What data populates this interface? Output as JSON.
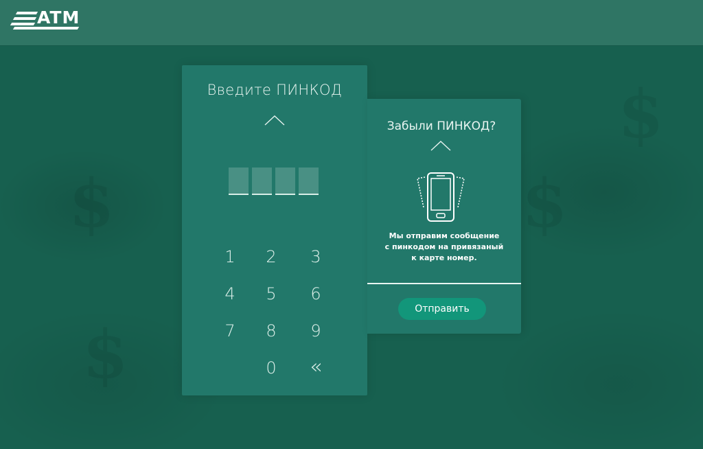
{
  "app": {
    "logo_text": "ATM"
  },
  "pin_panel": {
    "title": "Введите ПИНКОД",
    "digit_count": 4,
    "keys": [
      "1",
      "2",
      "3",
      "4",
      "5",
      "6",
      "7",
      "8",
      "9",
      "0",
      "«"
    ]
  },
  "forgot_panel": {
    "title": "Забыли ПИНКОД?",
    "message_line1": "Мы отправим сообщение",
    "message_line2": "с пинкодом на привязаный",
    "message_line3": "к карте номер.",
    "send_label": "Отправить"
  },
  "icons": {
    "caret_up": "chevron-up-icon",
    "phone": "phone-shake-icon",
    "backspace": "double-chevron-left-icon"
  },
  "colors": {
    "background": "#17604f",
    "header": "#2f7564",
    "panel": "#22786a",
    "button": "#12967a"
  }
}
